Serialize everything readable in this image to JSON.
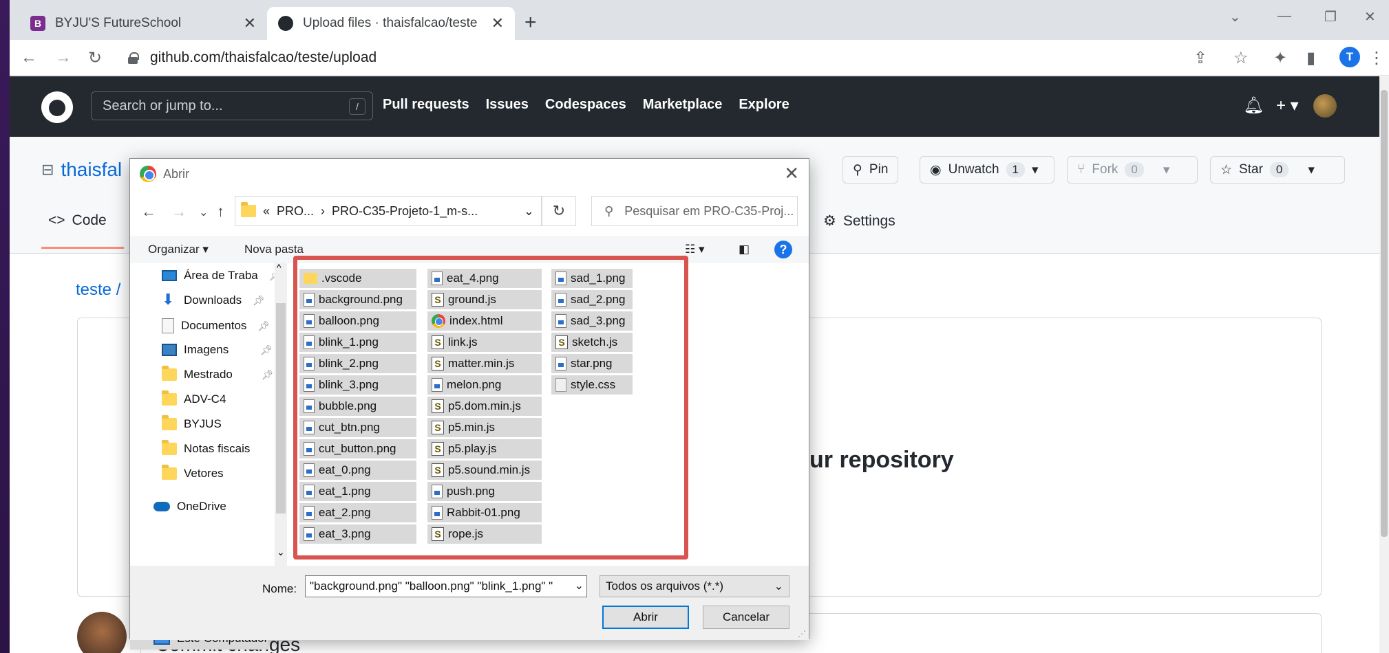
{
  "browser": {
    "tabs": [
      {
        "title": "BYJU'S FutureSchool",
        "icon": "byjus-icon"
      },
      {
        "title": "Upload files · thaisfalcao/teste",
        "icon": "github-icon"
      }
    ],
    "url": "github.com/thaisfalcao/teste/upload",
    "profile_initial": "T"
  },
  "github": {
    "search_placeholder": "Search or jump to...",
    "search_shortcut": "/",
    "nav": [
      "Pull requests",
      "Issues",
      "Codespaces",
      "Marketplace",
      "Explore"
    ],
    "repo_owner_partial": "thaisfal",
    "buttons": {
      "pin": "Pin",
      "unwatch": "Unwatch",
      "unwatch_count": "1",
      "fork": "Fork",
      "fork_count": "0",
      "star": "Star",
      "star_count": "0"
    },
    "tabs": {
      "code": "Code",
      "settings": "Settings"
    },
    "breadcrumb": "teste /",
    "upload_text_partial": "ur repository",
    "commit_title": "Commit changes"
  },
  "dialog": {
    "title": "Abrir",
    "path": {
      "prefix": "«",
      "part1": "PRO...",
      "sep": "›",
      "part2": "PRO-C35-Projeto-1_m-s..."
    },
    "search_placeholder": "Pesquisar em PRO-C35-Proj...",
    "organize": "Organizar ▾",
    "new_folder": "Nova pasta",
    "nav_items": [
      "Área de Traba",
      "Downloads",
      "Documentos",
      "Imagens",
      "Mestrado",
      "ADV-C4",
      "BYJUS",
      "Notas fiscais",
      "Vetores",
      "OneDrive",
      "Este Computador"
    ],
    "files_col1": [
      ".vscode",
      "background.png",
      "balloon.png",
      "blink_1.png",
      "blink_2.png",
      "blink_3.png",
      "bubble.png",
      "cut_btn.png",
      "cut_button.png",
      "eat_0.png",
      "eat_1.png",
      "eat_2.png",
      "eat_3.png"
    ],
    "files_col2": [
      "eat_4.png",
      "ground.js",
      "index.html",
      "link.js",
      "matter.min.js",
      "melon.png",
      "p5.dom.min.js",
      "p5.min.js",
      "p5.play.js",
      "p5.sound.min.js",
      "push.png",
      "Rabbit-01.png",
      "rope.js"
    ],
    "files_col3": [
      "sad_1.png",
      "sad_2.png",
      "sad_3.png",
      "sketch.js",
      "star.png",
      "style.css"
    ],
    "name_label": "Nome:",
    "name_value": "\"background.png\" \"balloon.png\" \"blink_1.png\" \"",
    "file_type": "Todos os arquivos (*.*)",
    "open_button": "Abrir",
    "cancel_button": "Cancelar"
  },
  "colors": {
    "highlight": "#d9534f",
    "github_dark": "#24292f",
    "link": "#0969da"
  }
}
